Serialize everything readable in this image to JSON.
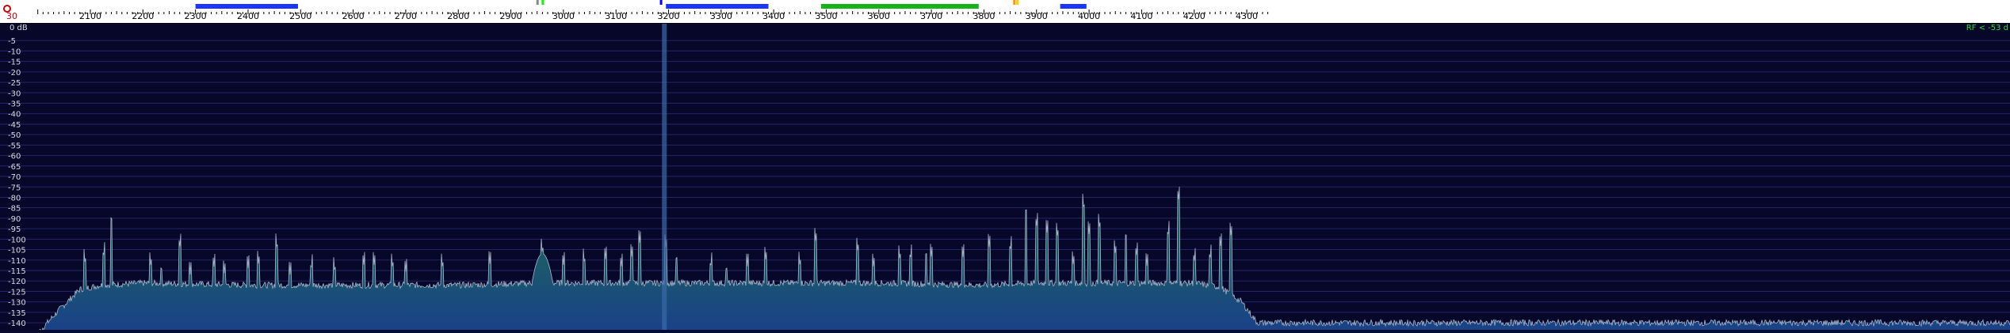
{
  "frequency_scale": {
    "start_label": "30",
    "labels": [
      "2100",
      "2200",
      "2300",
      "2400",
      "2500",
      "2600",
      "2700",
      "2800",
      "2900",
      "3000",
      "3100",
      "3200",
      "3300",
      "3400",
      "3500",
      "3600",
      "3700",
      "3800",
      "3900",
      "4000",
      "4100",
      "4200",
      "4300"
    ],
    "units_khz_min": 2000,
    "units_khz_max": 4337,
    "band_bars": [
      {
        "from": 2300,
        "to": 2495,
        "color": "#1a35ff"
      },
      {
        "from": 3195,
        "to": 3390,
        "color": "#1a35ff"
      },
      {
        "from": 3490,
        "to": 3790,
        "color": "#19b219"
      },
      {
        "from": 3945,
        "to": 3995,
        "color": "#1a35ff"
      }
    ],
    "markers": [
      {
        "freq": 2960,
        "color": "#00ff00"
      },
      {
        "freq": 2950,
        "color": "#888888"
      },
      {
        "freq": 3185,
        "color": "#0000ff"
      },
      {
        "freq": 3857,
        "color": "#ff9900"
      },
      {
        "freq": 3863,
        "color": "#ffcc00"
      },
      {
        "freq": 3830,
        "color": "#ffffff"
      },
      {
        "freq": 4120,
        "color": "#ffffff"
      }
    ]
  },
  "amplitude_axis": {
    "unit_label": "0 dB",
    "labels": [
      "-5",
      "-10",
      "-15",
      "-20",
      "-25",
      "-30",
      "-35",
      "-40",
      "-45",
      "-50",
      "-55",
      "-60",
      "-65",
      "-70",
      "-75",
      "-80",
      "-85",
      "-90",
      "-95",
      "-100",
      "-105",
      "-110",
      "-115",
      "-120",
      "-125",
      "-130",
      "-135",
      "-140"
    ]
  },
  "rf_indicator": "RF < -53 d",
  "tuned_frequency_khz": 3192,
  "chart_data": {
    "type": "area",
    "x_unit": "kHz",
    "y_unit": "dB",
    "xlim": [
      2000,
      4337
    ],
    "ylim": [
      -143,
      0
    ],
    "noise_floor": [
      [
        2000,
        -145
      ],
      [
        2040,
        -134
      ],
      [
        2080,
        -124
      ],
      [
        2120,
        -122
      ],
      [
        2200,
        -121
      ],
      [
        2400,
        -122
      ],
      [
        2600,
        -122
      ],
      [
        2800,
        -122
      ],
      [
        2950,
        -121
      ],
      [
        3000,
        -121
      ],
      [
        3200,
        -121
      ],
      [
        3400,
        -121
      ],
      [
        3600,
        -121
      ],
      [
        3800,
        -122
      ],
      [
        3900,
        -121
      ],
      [
        4000,
        -121
      ],
      [
        4100,
        -121
      ],
      [
        4200,
        -121
      ],
      [
        4250,
        -123
      ],
      [
        4290,
        -130
      ],
      [
        4320,
        -140
      ]
    ],
    "peaks": [
      [
        2090,
        -113
      ],
      [
        2125,
        -110
      ],
      [
        2140,
        -93
      ],
      [
        2215,
        -114
      ],
      [
        2235,
        -117
      ],
      [
        2270,
        -105
      ],
      [
        2290,
        -117
      ],
      [
        2335,
        -114
      ],
      [
        2355,
        -117
      ],
      [
        2400,
        -114
      ],
      [
        2420,
        -113
      ],
      [
        2455,
        -106
      ],
      [
        2480,
        -117
      ],
      [
        2520,
        -116
      ],
      [
        2565,
        -117
      ],
      [
        2620,
        -113
      ],
      [
        2640,
        -113
      ],
      [
        2675,
        -115
      ],
      [
        2700,
        -116
      ],
      [
        2770,
        -115
      ],
      [
        2860,
        -112
      ],
      [
        2960,
        -108
      ],
      [
        3000,
        -113
      ],
      [
        3040,
        -113
      ],
      [
        3080,
        -110
      ],
      [
        3110,
        -114
      ],
      [
        3130,
        -109
      ],
      [
        3145,
        -102
      ],
      [
        3195,
        -105
      ],
      [
        3215,
        -112
      ],
      [
        3280,
        -115
      ],
      [
        3310,
        -117
      ],
      [
        3350,
        -113
      ],
      [
        3385,
        -111
      ],
      [
        3450,
        -114
      ],
      [
        3480,
        -102
      ],
      [
        3560,
        -107
      ],
      [
        3590,
        -114
      ],
      [
        3640,
        -111
      ],
      [
        3660,
        -111
      ],
      [
        3690,
        -110
      ],
      [
        3700,
        -109
      ],
      [
        3760,
        -109
      ],
      [
        3810,
        -104
      ],
      [
        3850,
        -107
      ],
      [
        3880,
        -89
      ],
      [
        3900,
        -95
      ],
      [
        3920,
        -97
      ],
      [
        3940,
        -100
      ],
      [
        3970,
        -113
      ],
      [
        3990,
        -87
      ],
      [
        4000,
        -98
      ],
      [
        4020,
        -96
      ],
      [
        4050,
        -108
      ],
      [
        4070,
        -101
      ],
      [
        4090,
        -109
      ],
      [
        4110,
        -113
      ],
      [
        4150,
        -100
      ],
      [
        4170,
        -82
      ],
      [
        4200,
        -112
      ],
      [
        4230,
        -111
      ],
      [
        4250,
        -104
      ],
      [
        4270,
        -99
      ]
    ],
    "carrier_peaks": [
      [
        2960,
        -107
      ]
    ]
  }
}
